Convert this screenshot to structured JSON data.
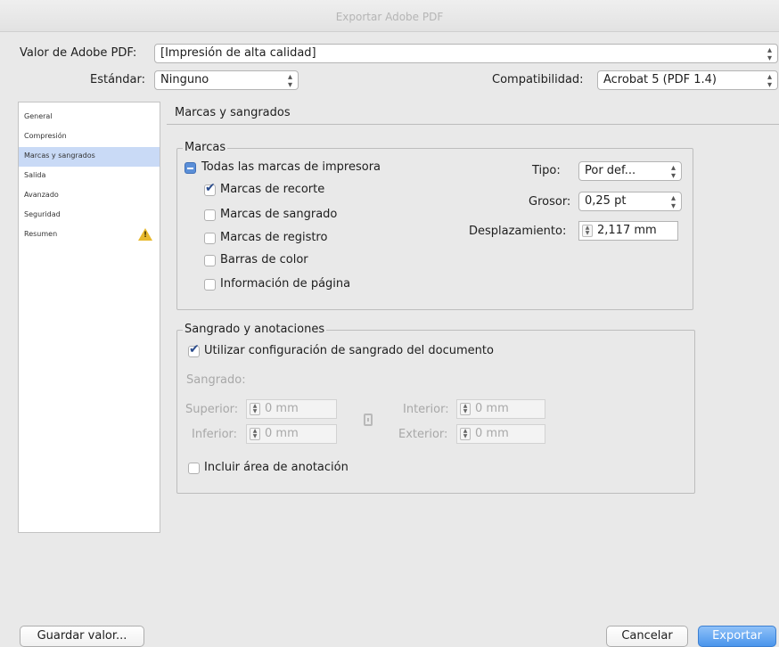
{
  "window": {
    "title": "Exportar Adobe PDF"
  },
  "preset": {
    "label": "Valor de Adobe PDF:",
    "value": "[Impresión de alta calidad]"
  },
  "standard": {
    "label": "Estándar:",
    "value": "Ninguno"
  },
  "compatibility": {
    "label": "Compatibilidad:",
    "value": "Acrobat 5 (PDF 1.4)"
  },
  "sidebar": {
    "items": [
      {
        "label": "General"
      },
      {
        "label": "Compresión"
      },
      {
        "label": "Marcas y sangrados"
      },
      {
        "label": "Salida"
      },
      {
        "label": "Avanzado"
      },
      {
        "label": "Seguridad"
      },
      {
        "label": "Resumen"
      }
    ],
    "selected_index": 2,
    "warning_icon": "warning-icon"
  },
  "panel": {
    "title": "Marcas y sangrados",
    "marks": {
      "legend": "Marcas",
      "all_marks": {
        "label": "Todas las marcas de impresora",
        "state": "mixed"
      },
      "items": [
        {
          "label": "Marcas de recorte",
          "checked": true
        },
        {
          "label": "Marcas de sangrado",
          "checked": false
        },
        {
          "label": "Marcas de registro",
          "checked": false
        },
        {
          "label": "Barras de color",
          "checked": false
        },
        {
          "label": "Información de página",
          "checked": false
        }
      ],
      "type": {
        "label": "Tipo:",
        "value": "Por def..."
      },
      "weight": {
        "label": "Grosor:",
        "value": "0,25 pt"
      },
      "offset": {
        "label": "Desplazamiento:",
        "value": "2,117 mm"
      }
    },
    "bleed": {
      "legend": "Sangrado y anotaciones",
      "use_doc": {
        "label": "Utilizar configuración de sangrado del documento",
        "checked": true
      },
      "bleed_label": "Sangrado:",
      "top": {
        "label": "Superior:",
        "value": "0 mm"
      },
      "bottom": {
        "label": "Inferior:",
        "value": "0 mm"
      },
      "inside": {
        "label": "Interior:",
        "value": "0 mm"
      },
      "outside": {
        "label": "Exterior:",
        "value": "0 mm"
      },
      "slug": {
        "label": "Incluir área de anotación",
        "checked": false
      }
    }
  },
  "buttons": {
    "save_preset": "Guardar valor...",
    "cancel": "Cancelar",
    "export": "Exportar"
  },
  "colors": {
    "selection": "#c9daf6",
    "primary_button": "#4a95ec",
    "warning": "#e8b92c"
  }
}
